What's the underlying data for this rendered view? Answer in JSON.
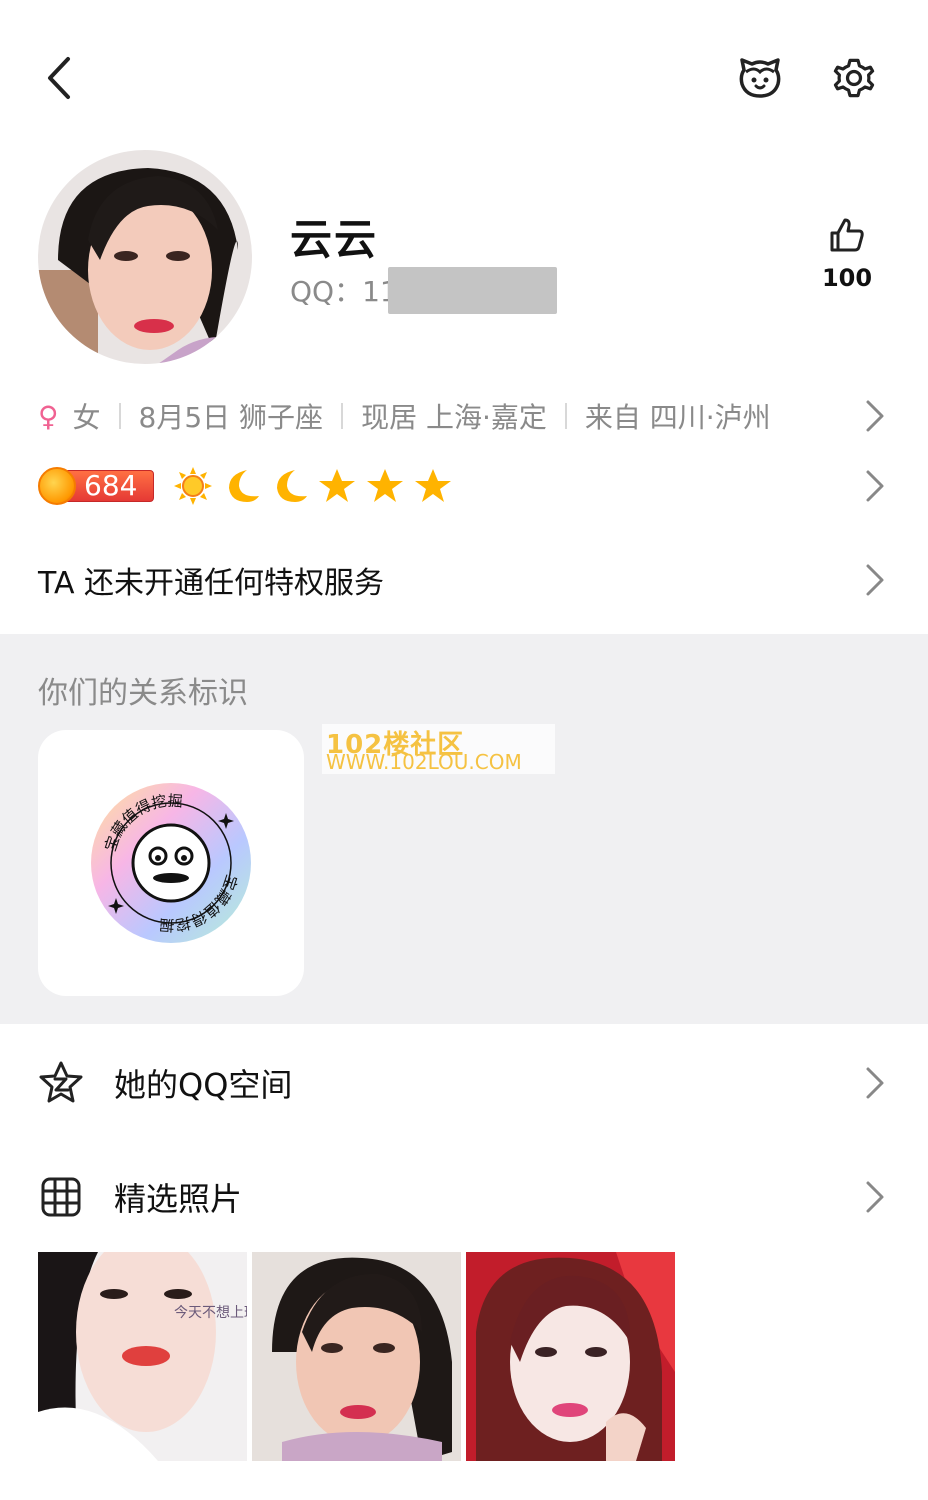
{
  "header": {
    "back_icon": "chevron-left-icon",
    "pet_icon": "pet-face-icon",
    "settings_icon": "gear-icon"
  },
  "profile": {
    "nickname": "云云",
    "qq_label": "QQ：11",
    "like_count": "100"
  },
  "info": {
    "gender_symbol": "♀",
    "gender": "女",
    "birthday": "8月5日 狮子座",
    "residence": "现居 上海·嘉定",
    "hometown": "来自 四川·泸州"
  },
  "level": {
    "value": "684",
    "icons": [
      "sun-icon",
      "moon-icon",
      "moon-icon",
      "star-icon",
      "star-icon",
      "star-icon"
    ]
  },
  "privilege": {
    "text": "TA 还未开通任何特权服务"
  },
  "relation": {
    "title": "你们的关系标识",
    "badge_text_top": "宝藏值得挖掘",
    "badge_text_bottom": "宝藏值得挖掘",
    "watermark_line1": "102楼社区",
    "watermark_line2": "WWW.102LOU.COM"
  },
  "menu": {
    "qzone_label": "她的QQ空间",
    "photos_label": "精选照片"
  },
  "photos": {
    "photo1_overlay": "今天不想上班",
    "items": [
      "photo-1",
      "photo-2",
      "photo-3"
    ]
  },
  "colors": {
    "accent_female": "#f06292",
    "section_bg": "#f0f0f2",
    "muted_text": "#8a8a8a",
    "level_badge": "#e53935"
  }
}
